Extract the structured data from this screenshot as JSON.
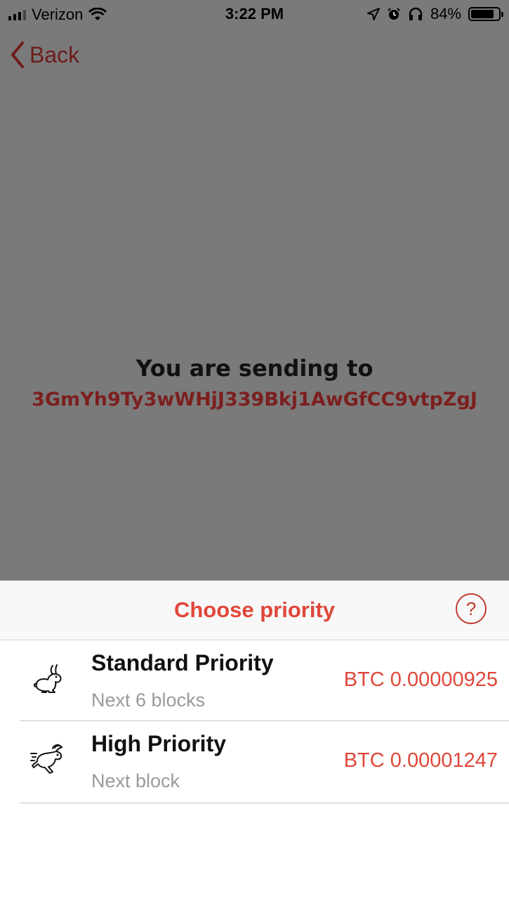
{
  "status_bar": {
    "carrier": "Verizon",
    "time": "3:22 PM",
    "battery": "84%",
    "battery_level": 0.84
  },
  "nav": {
    "back_label": "Back"
  },
  "sending": {
    "label": "You are sending to",
    "address": "3GmYh9Ty3wWHjJ339Bkj1AwGfCC9vtpZgJ"
  },
  "sheet": {
    "title": "Choose priority",
    "help_label": "?",
    "options": [
      {
        "title": "Standard Priority",
        "subtitle": "Next 6 blocks",
        "price": "BTC 0.00000925",
        "icon": "rabbit-sitting-icon"
      },
      {
        "title": "High Priority",
        "subtitle": "Next block",
        "price": "BTC 0.00001247",
        "icon": "rabbit-running-icon"
      }
    ]
  },
  "colors": {
    "accent": "#e0473a",
    "address": "#7c1f1f",
    "backdrop": "#7a7a7a"
  }
}
